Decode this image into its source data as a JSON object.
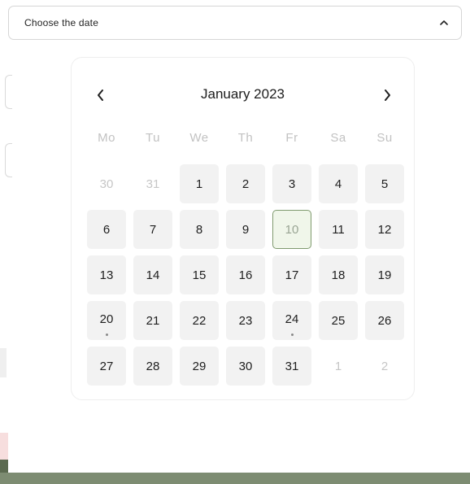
{
  "dropdown": {
    "label": "Choose the date",
    "expanded": true
  },
  "calendar": {
    "month_label": "January 2023",
    "prev_icon": "chevron-left-icon",
    "next_icon": "chevron-right-icon",
    "weekdays": [
      "Mo",
      "Tu",
      "We",
      "Th",
      "Fr",
      "Sa",
      "Su"
    ],
    "days": [
      {
        "label": "30",
        "other": true
      },
      {
        "label": "31",
        "other": true
      },
      {
        "label": "1"
      },
      {
        "label": "2"
      },
      {
        "label": "3"
      },
      {
        "label": "4"
      },
      {
        "label": "5"
      },
      {
        "label": "6"
      },
      {
        "label": "7"
      },
      {
        "label": "8"
      },
      {
        "label": "9"
      },
      {
        "label": "10",
        "today": true
      },
      {
        "label": "11"
      },
      {
        "label": "12"
      },
      {
        "label": "13"
      },
      {
        "label": "14"
      },
      {
        "label": "15"
      },
      {
        "label": "16"
      },
      {
        "label": "17"
      },
      {
        "label": "18"
      },
      {
        "label": "19"
      },
      {
        "label": "20",
        "dot": true
      },
      {
        "label": "21"
      },
      {
        "label": "22"
      },
      {
        "label": "23"
      },
      {
        "label": "24",
        "dot": true
      },
      {
        "label": "25"
      },
      {
        "label": "26"
      },
      {
        "label": "27"
      },
      {
        "label": "28"
      },
      {
        "label": "29"
      },
      {
        "label": "30"
      },
      {
        "label": "31"
      },
      {
        "label": "1",
        "other": true
      },
      {
        "label": "2",
        "other": true
      }
    ]
  },
  "colors": {
    "today_border": "#7f9a6e",
    "today_bg": "#f0f6ea",
    "footer": "#7d8c72",
    "day_bg": "#f2f2f2"
  }
}
